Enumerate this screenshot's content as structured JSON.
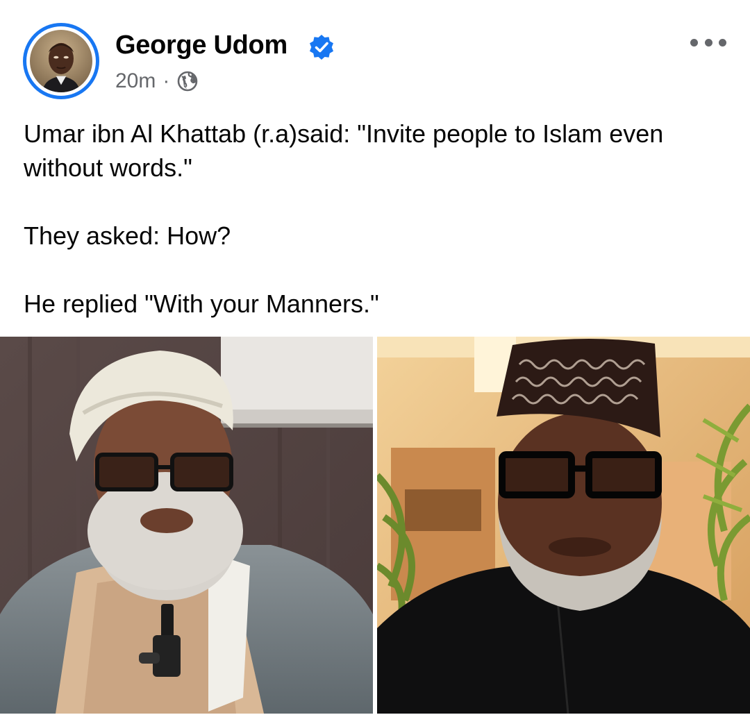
{
  "post": {
    "author": {
      "name": "George Udom",
      "verified": true,
      "avatar_icon": "profile-photo"
    },
    "time": "20m",
    "separator": "·",
    "audience_icon": "globe-icon",
    "more_icon": "more-horizontal-icon",
    "text": {
      "line1": "Umar ibn Al Khattab (r.a)said: \"Invite people to Islam even without words.\"",
      "line2": "They asked: How?",
      "line3": "He replied \"With your Manners.\""
    },
    "photos": [
      {
        "subject": "man-with-white-turban-and-glasses"
      },
      {
        "subject": "man-with-embroidered-cap-and-glasses"
      }
    ]
  },
  "colors": {
    "accent": "#1877f2",
    "secondary_text": "#65676b",
    "primary_text": "#050505"
  }
}
